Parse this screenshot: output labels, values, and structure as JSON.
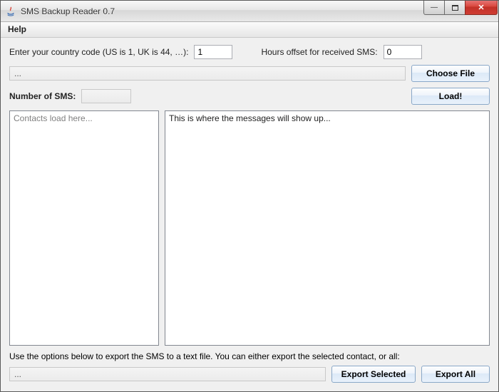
{
  "window": {
    "title": "SMS Backup Reader 0.7"
  },
  "menu": {
    "help": "Help"
  },
  "form": {
    "country_label": "Enter your country code (US is 1, UK is 44, …):",
    "country_value": "1",
    "offset_label": "Hours offset for received SMS:",
    "offset_value": "0",
    "file_path": "...",
    "choose_file": "Choose File",
    "sms_count_label": "Number of SMS:",
    "sms_count_value": "",
    "load": "Load!"
  },
  "panes": {
    "contacts_placeholder": "Contacts load here...",
    "messages_placeholder": "This is where the messages will show up..."
  },
  "export": {
    "instructions": "Use the options below to export the SMS to a text file. You can either export the selected contact, or all:",
    "path": "...",
    "selected": "Export Selected",
    "all": "Export All"
  }
}
